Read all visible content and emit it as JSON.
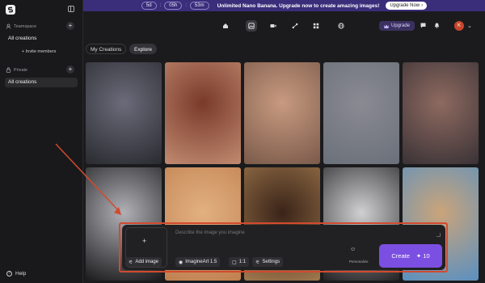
{
  "banner": {
    "timer": [
      "5d",
      "05h",
      "53m"
    ],
    "separator": ":",
    "message": "Unlimited Nano Banana. Upgrade now to create amazing images!",
    "cta": "Upgrade Now",
    "cta_arrow": "›"
  },
  "sidebar": {
    "teamspace_label": "Teamspace",
    "teamspace_item": "All creations",
    "invite_label": "+ Invite members",
    "private_label": "Private",
    "private_item": "All creations",
    "help": "Help",
    "help_glyph": "?",
    "plus": "+"
  },
  "toolbar": {
    "icons": [
      "home-icon",
      "image-icon",
      "video-icon",
      "workflow-icon",
      "apps-icon",
      "globe-icon"
    ],
    "active_index": 1,
    "upgrade": "Upgrade",
    "avatar_initial": "K",
    "chevron": "⌄"
  },
  "tabs": [
    "My Creations",
    "Explore"
  ],
  "active_tab": 1,
  "grid": {
    "tiles": [
      [
        "#6b6b7a",
        "#2a2a30"
      ],
      [
        "#7a3a2a",
        "#c08a70"
      ],
      [
        "#c89a80",
        "#7a5a4a"
      ],
      [
        "#8a8a92",
        "#6a707a"
      ],
      [
        "#8e6a60",
        "#3a3236"
      ],
      [
        "#b0b0b6",
        "#1a1a1c"
      ],
      [
        "#e2b080",
        "#c08050"
      ],
      [
        "#3a2418",
        "#a0784e"
      ],
      [
        "#d0d0d2",
        "#222224"
      ],
      [
        "#caa47a",
        "#5a90c0"
      ]
    ]
  },
  "prompt": {
    "placeholder": "Describe the image you imagine",
    "add_plus": "+",
    "add_image": "Add image",
    "model": "ImagineArt 1.5",
    "ratio": "1:1",
    "settings": "Settings",
    "personalize": "Personalize",
    "create": "Create",
    "credits": "10"
  }
}
